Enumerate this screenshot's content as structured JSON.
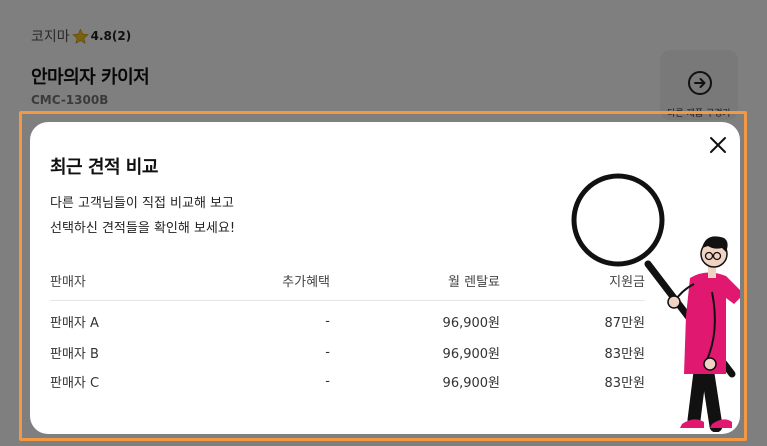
{
  "background": {
    "brand": "코지마",
    "rating": "4.8(2)",
    "product_name": "안마의자 카이저",
    "model": "CMC-1300B",
    "other_button_label": "다른 제품 구경가"
  },
  "modal": {
    "title": "최근 견적 비교",
    "description_line1": "다른 고객님들이 직접 비교해 보고",
    "description_line2": "선택하신 견적들을 확인해 보세요!",
    "table": {
      "headers": [
        "판매자",
        "추가혜택",
        "월 렌탈료",
        "지원금"
      ],
      "rows": [
        [
          "판매자 A",
          "-",
          "96,900원",
          "87만원"
        ],
        [
          "판매자 B",
          "-",
          "96,900원",
          "83만원"
        ],
        [
          "판매자 C",
          "-",
          "96,900원",
          "83만원"
        ]
      ]
    }
  },
  "colors": {
    "highlight": "#f39843",
    "accent_pink": "#e0186f",
    "star": "#f4c21f"
  },
  "icons": {
    "close": "close-icon",
    "star": "star-icon",
    "arrow": "arrow-right-circle-icon"
  }
}
